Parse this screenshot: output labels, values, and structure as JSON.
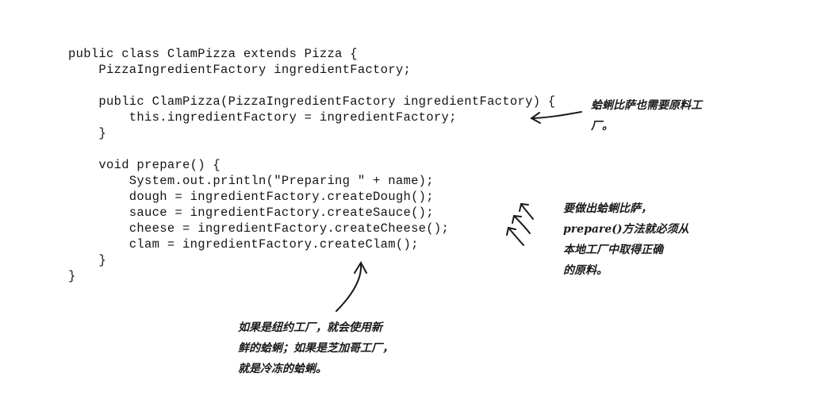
{
  "code": {
    "lines": [
      "public class ClamPizza extends Pizza {",
      "    PizzaIngredientFactory ingredientFactory;",
      "",
      "    public ClamPizza(PizzaIngredientFactory ingredientFactory) {",
      "        this.ingredientFactory = ingredientFactory;",
      "    }",
      "",
      "    void prepare() {",
      "        System.out.println(\"Preparing \" + name);",
      "        dough = ingredientFactory.createDough();",
      "        sauce = ingredientFactory.createSauce();",
      "        cheese = ingredientFactory.createCheese();",
      "        clam = ingredientFactory.createClam();",
      "    }",
      "}"
    ]
  },
  "annotations": {
    "constructor_note": [
      "蛤蜊比萨也需要原料工",
      "厂。"
    ],
    "prepare_note": [
      "要做出蛤蜊比萨，",
      "prepare()方法就必须从",
      "本地工厂中取得正确",
      "的原料。"
    ],
    "clam_note": [
      "如果是纽约工厂，就会使用新",
      "鲜的蛤蜊；如果是芝加哥工厂，",
      "就是冷冻的蛤蜊。"
    ]
  }
}
